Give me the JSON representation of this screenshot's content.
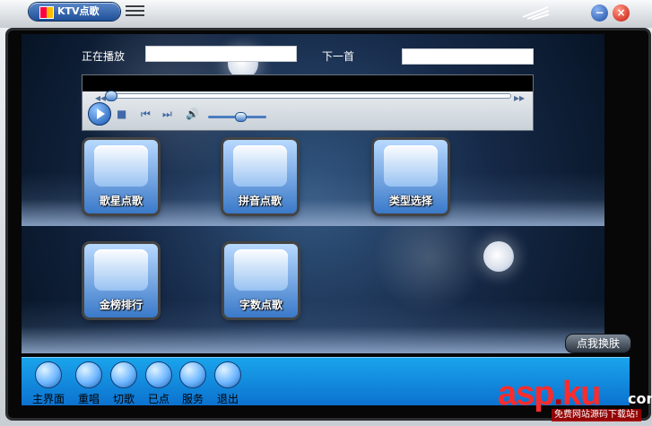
{
  "window": {
    "title": "KTV点歌",
    "buttons": {
      "minimize_icon": "minimize-icon",
      "close_icon": "close-icon"
    }
  },
  "top": {
    "now_playing_label": "正在播放",
    "now_playing_value": "",
    "next_label": "下一首",
    "next_value": ""
  },
  "player": {
    "play_icon": "play-icon",
    "stop_icon": "stop-icon",
    "prev_icon": "previous-icon",
    "next_icon": "next-icon",
    "volume_icon": "volume-icon",
    "seek_value": 0.0,
    "volume_level": 0.5
  },
  "menu_tiles": [
    {
      "label": "歌星点歌",
      "icon": "singer-icon"
    },
    {
      "label": "拼音点歌",
      "icon": "pinyin-icon"
    },
    {
      "label": "类型选择",
      "icon": "category-icon"
    },
    {
      "label": "金榜排行",
      "icon": "ranking-icon"
    },
    {
      "label": "字数点歌",
      "icon": "word-count-icon"
    }
  ],
  "skin_button": "点我换肤",
  "bottom_bar": {
    "items": [
      {
        "label": "主界面",
        "icon": "home-icon"
      },
      {
        "label": "重唱",
        "icon": "replay-icon"
      },
      {
        "label": "切歌",
        "icon": "skip-icon"
      },
      {
        "label": "已点",
        "icon": "selected-icon"
      },
      {
        "label": "服务",
        "icon": "service-icon"
      },
      {
        "label": "退出",
        "icon": "exit-icon"
      }
    ]
  },
  "watermark": {
    "text_asp": "asp",
    "text_ku": "ku",
    "dot": ".",
    "com": "com",
    "sub": "免费网站源码下载站!"
  },
  "colors": {
    "accent_blue": "#1aa4ec",
    "title_blue": "#1e4f98",
    "close_red": "#c8150b",
    "watermark_red": "#ff2b2b"
  }
}
